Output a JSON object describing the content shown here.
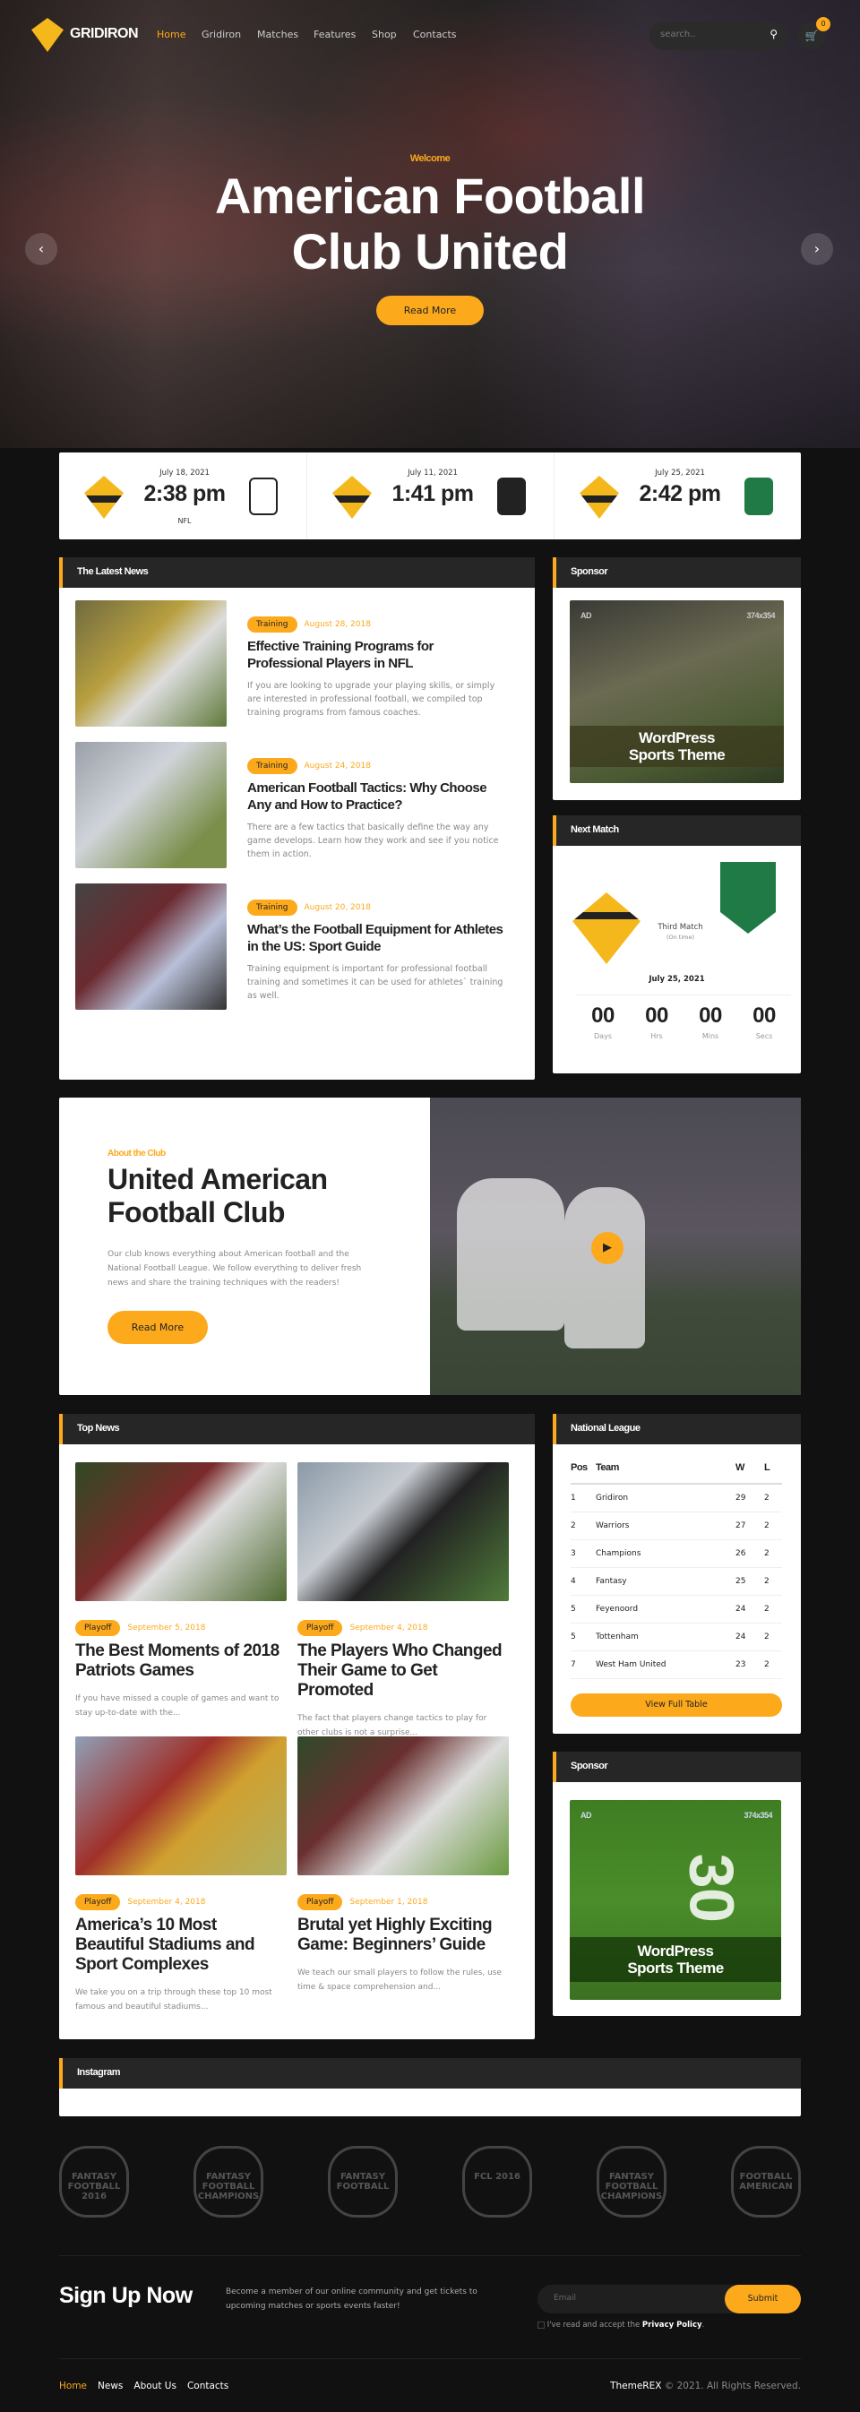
{
  "colors": {
    "accent": "#fca91c",
    "dark": "#111111",
    "panel": "#262626"
  },
  "header": {
    "brand": "GRIDIRON",
    "logo_text": "AMERICAN FOOTBALL",
    "nav": [
      "Home",
      "Gridiron",
      "Matches",
      "Features",
      "Shop",
      "Contacts"
    ],
    "active": "Home",
    "search_placeholder": "search..",
    "cart_count": "0"
  },
  "hero": {
    "eyebrow": "Welcome",
    "title_line1": "American Football",
    "title_line2": "Club United",
    "button": "Read More"
  },
  "matches": [
    {
      "date": "July 18, 2021",
      "time": "2:38 pm",
      "label": "NFL",
      "home_logo": "AMERICAN FOOTBALL",
      "away_logo": "FCL"
    },
    {
      "date": "July 11, 2021",
      "time": "1:41 pm",
      "label": "",
      "home_logo": "AMERICAN FOOTBALL",
      "away_logo": "FANTASY FOOTBALL"
    },
    {
      "date": "July 25, 2021",
      "time": "2:42 pm",
      "label": "",
      "home_logo": "AMERICAN FOOTBALL",
      "away_logo": "FANTASY FOOTBALL CHAMPIONS"
    }
  ],
  "latest": {
    "heading": "The Latest News",
    "items": [
      {
        "tag": "Training",
        "date": "August 28, 2018",
        "title": "Effective Training Programs for Professional Players in NFL",
        "excerpt": "If you are looking to upgrade your playing skills, or simply are interested in professional football, we compiled top training programs from famous coaches."
      },
      {
        "tag": "Training",
        "date": "August 24, 2018",
        "title": "American Football Tactics: Why Choose Any and How to Practice?",
        "excerpt": "There are a few tactics that basically define the way any game develops. Learn how they work and see if you notice them in action."
      },
      {
        "tag": "Training",
        "date": "August 20, 2018",
        "title": "What’s the Football Equipment for Athletes in the US: Sport Guide",
        "excerpt": "Training equipment is important for professional football training and sometimes it can be used for athletes` training as well."
      }
    ]
  },
  "sponsor1": {
    "heading": "Sponsor",
    "ad": "AD",
    "size": "374x354",
    "line1": "WordPress",
    "line2": "Sports Theme"
  },
  "next_match": {
    "heading": "Next Match",
    "home": "AMERICAN FOOTBALL",
    "away": "FANTASY FOOTBALL CHAMPIONS",
    "round": "Third Match",
    "status": "(On time)",
    "date": "July 25, 2021",
    "countdown": [
      {
        "value": "00",
        "unit": "Days"
      },
      {
        "value": "00",
        "unit": "Hrs"
      },
      {
        "value": "00",
        "unit": "Mins"
      },
      {
        "value": "00",
        "unit": "Secs"
      }
    ]
  },
  "about": {
    "eyebrow": "About the Club",
    "title_line1": "United American",
    "title_line2": "Football Club",
    "text": "Our club knows everything about American football and the National Football League. We follow everything to deliver fresh news and share the training techniques with the readers!",
    "button": "Read More"
  },
  "top_news": {
    "heading": "Top News",
    "items": [
      {
        "tag": "Playoff",
        "date": "September 5, 2018",
        "title": "The Best Moments of 2018 Patriots Games",
        "excerpt": "If you have missed a couple of games and want to stay up-to-date with the..."
      },
      {
        "tag": "Playoff",
        "date": "September 4, 2018",
        "title": "The Players Who Changed Their Game to Get Promoted",
        "excerpt": "The fact that players change tactics to play for other clubs is not a surprise..."
      },
      {
        "tag": "Playoff",
        "date": "September 4, 2018",
        "title": "America’s 10 Most Beautiful Stadiums and Sport Complexes",
        "excerpt": "We take you on a trip through these top 10 most famous and beautiful stadiums..."
      },
      {
        "tag": "Playoff",
        "date": "September 1, 2018",
        "title": "Brutal yet Highly Exciting Game: Beginners’ Guide",
        "excerpt": "We teach our small players to follow the rules, use time & space comprehension and..."
      }
    ]
  },
  "league": {
    "heading": "National League",
    "columns": [
      "Pos",
      "Team",
      "W",
      "L"
    ],
    "rows": [
      [
        "1",
        "Gridiron",
        "29",
        "2"
      ],
      [
        "2",
        "Warriors",
        "27",
        "2"
      ],
      [
        "3",
        "Champions",
        "26",
        "2"
      ],
      [
        "4",
        "Fantasy",
        "25",
        "2"
      ],
      [
        "5",
        "Feyenoord",
        "24",
        "2"
      ],
      [
        "5",
        "Tottenham",
        "24",
        "2"
      ],
      [
        "7",
        "West Ham United",
        "23",
        "2"
      ]
    ],
    "button": "View Full Table"
  },
  "sponsor2": {
    "heading": "Sponsor",
    "ad": "AD",
    "size": "374x354",
    "line1": "WordPress",
    "line2": "Sports Theme"
  },
  "instagram": {
    "heading": "Instagram"
  },
  "partner_logos": [
    "FANTASY FOOTBALL 2016",
    "FANTASY FOOTBALL CHAMPIONS",
    "FANTASY FOOTBALL",
    "FCL 2016",
    "FANTASY FOOTBALL CHAMPIONS",
    "FOOTBALL AMERICAN"
  ],
  "signup": {
    "title": "Sign Up Now",
    "text": "Become a member of our online community and get tickets to upcoming matches or sports events faster!",
    "placeholder": "Email",
    "button": "Submit",
    "consent_prefix": "I've read and accept the ",
    "consent_link": "Privacy Policy",
    "consent_suffix": "."
  },
  "footer": {
    "links": [
      "Home",
      "News",
      "About Us",
      "Contacts"
    ],
    "brand": "ThemeREX",
    "copyright": " © 2021. All Rights Reserved."
  }
}
